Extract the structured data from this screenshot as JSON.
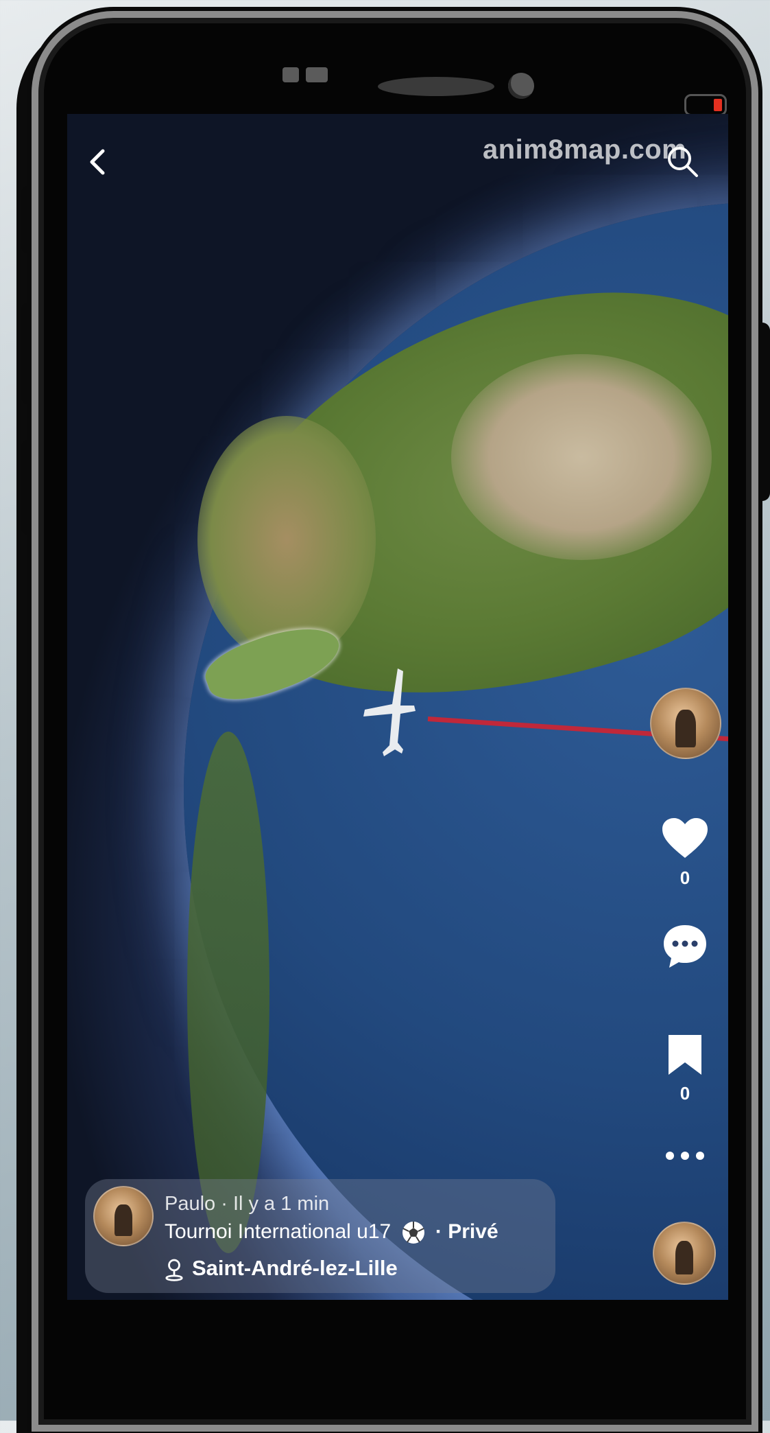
{
  "watermark": "anim8map.com",
  "actions": {
    "likes": "0",
    "saves": "0"
  },
  "post": {
    "meta": "Paulo · Il y a 1 min",
    "title": "Tournoi International u17",
    "privacy": "· Privé",
    "location": "Saint-André-lez-Lille"
  },
  "colors": {
    "route": "#c0283a",
    "ocean": "#22497e",
    "land": "#5b7a34"
  }
}
